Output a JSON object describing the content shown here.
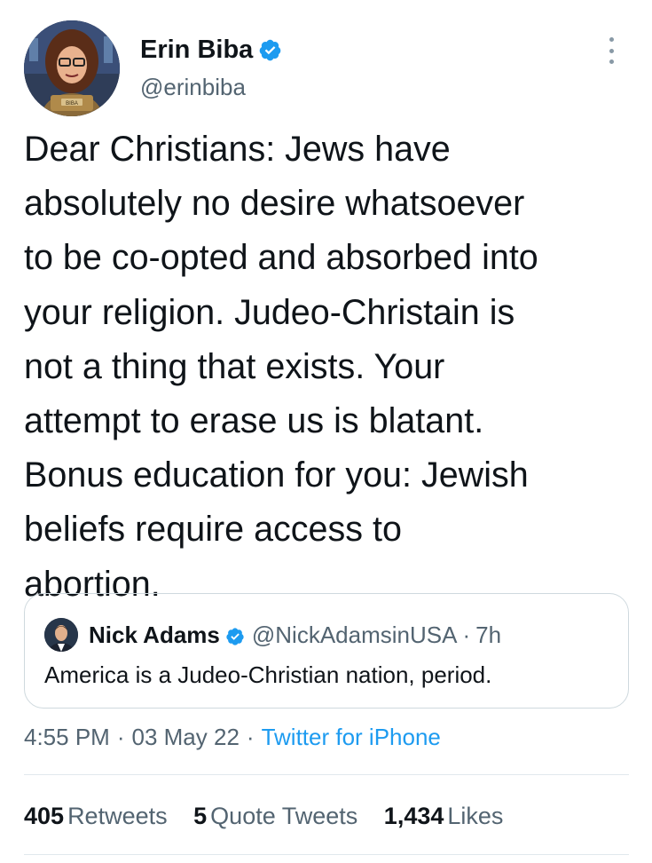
{
  "author": {
    "name": "Erin Biba",
    "handle": "@erinbiba",
    "avatar_plaque_text": "BIBA",
    "verified_color": "#1d9bf0"
  },
  "tweet": {
    "text_lines": [
      "Dear Christians: Jews have",
      "absolutely no desire whatsoever",
      "to be co-opted and absorbed into",
      "your religion. Judeo-Christain is",
      "not a thing that exists. Your",
      "attempt to erase us is blatant.",
      "Bonus education for you: Jewish",
      "beliefs require access to",
      "abortion."
    ]
  },
  "quote": {
    "name": "Nick Adams",
    "handle": "@NickAdamsinUSA",
    "separator": "·",
    "time": "7h",
    "text": "America is a Judeo-Christian nation, period."
  },
  "meta": {
    "time": "4:55 PM",
    "date": "03 May 22",
    "separator": "·",
    "source": "Twitter for iPhone"
  },
  "stats": {
    "retweets_count": "405",
    "retweets_label": "Retweets",
    "quotes_count": "5",
    "quotes_label": "Quote Tweets",
    "likes_count": "1,434",
    "likes_label": "Likes"
  },
  "icons": {
    "more": "more-vertical-icon",
    "verified": "verified-badge-icon"
  },
  "colors": {
    "text": "#0f1419",
    "secondary": "#536471",
    "link": "#1d9bf0",
    "border": "#cfd9de"
  }
}
